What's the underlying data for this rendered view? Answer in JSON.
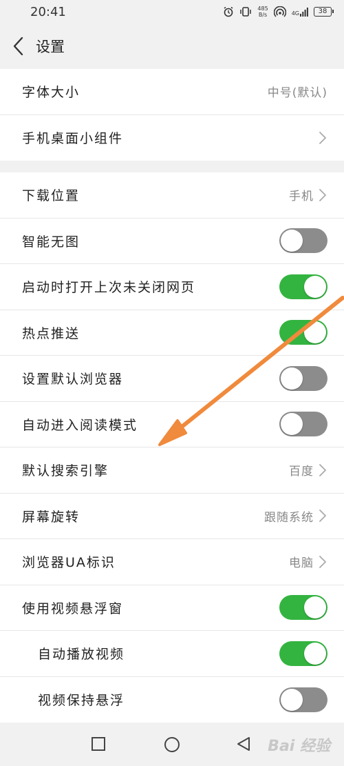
{
  "status_bar": {
    "time": "20:41",
    "net_speed_value": "485",
    "net_speed_unit": "B/s",
    "network": "4G",
    "battery": "38",
    "icons": [
      "alarm-icon",
      "vibrate-icon",
      "hotspot-icon",
      "signal-icon",
      "battery-icon"
    ]
  },
  "header": {
    "title": "设置",
    "back_icon": "chevron-left-icon"
  },
  "section1": {
    "items": [
      {
        "label": "字体大小",
        "value": "中号(默认)"
      },
      {
        "label": "手机桌面小组件",
        "value": ""
      }
    ]
  },
  "section2": {
    "items": [
      {
        "label": "下载位置",
        "value": "手机",
        "type": "link"
      },
      {
        "label": "智能无图",
        "type": "toggle",
        "on": false
      },
      {
        "label": "启动时打开上次未关闭网页",
        "type": "toggle",
        "on": true
      },
      {
        "label": "热点推送",
        "type": "toggle",
        "on": true
      },
      {
        "label": "设置默认浏览器",
        "type": "toggle",
        "on": false
      },
      {
        "label": "自动进入阅读模式",
        "type": "toggle",
        "on": false
      },
      {
        "label": "默认搜索引擎",
        "value": "百度",
        "type": "link"
      },
      {
        "label": "屏幕旋转",
        "value": "跟随系统",
        "type": "link"
      },
      {
        "label": "浏览器UA标识",
        "value": "电脑",
        "type": "link"
      },
      {
        "label": "使用视频悬浮窗",
        "type": "toggle",
        "on": true
      },
      {
        "label": "自动播放视频",
        "type": "toggle",
        "on": true,
        "indent": true
      },
      {
        "label": "视频保持悬浮",
        "type": "toggle",
        "on": false,
        "indent": true
      }
    ]
  },
  "nav_bar": {
    "icons": [
      "recent-apps-icon",
      "home-icon",
      "back-icon"
    ]
  },
  "watermark": "Bai 经验",
  "colors": {
    "toggle_on": "#33b440",
    "toggle_off": "#8c8c8c",
    "arrow": "#f08a3c",
    "background": "#f1f1f1"
  }
}
